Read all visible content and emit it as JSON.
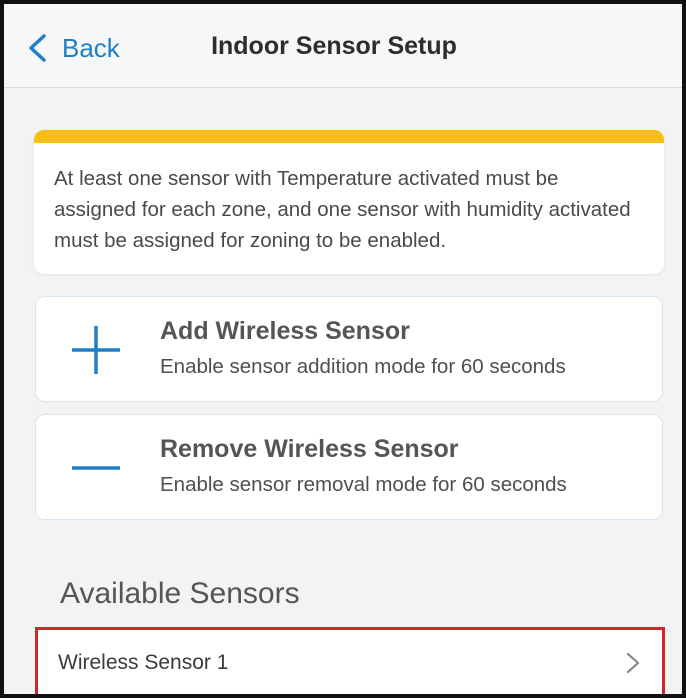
{
  "header": {
    "back_label": "Back",
    "title": "Indoor Sensor Setup"
  },
  "notice": {
    "text": "At least one sensor with Temperature activated must be assigned for each zone, and one sensor with humidity activated must be assigned for zoning to be enabled.",
    "accent_color": "#F7BD18"
  },
  "actions": [
    {
      "icon": "plus-icon",
      "title": "Add Wireless Sensor",
      "subtitle": "Enable sensor addition mode for 60 seconds"
    },
    {
      "icon": "minus-icon",
      "title": "Remove Wireless Sensor",
      "subtitle": "Enable sensor removal mode for 60 seconds"
    }
  ],
  "available_sensors": {
    "heading": "Available Sensors",
    "items": [
      {
        "label": "Wireless Sensor 1",
        "icon": "chevron-right-icon",
        "highlighted": true
      }
    ]
  },
  "colors": {
    "link_blue": "#1F7FC5",
    "highlight_red": "#D0262F"
  }
}
